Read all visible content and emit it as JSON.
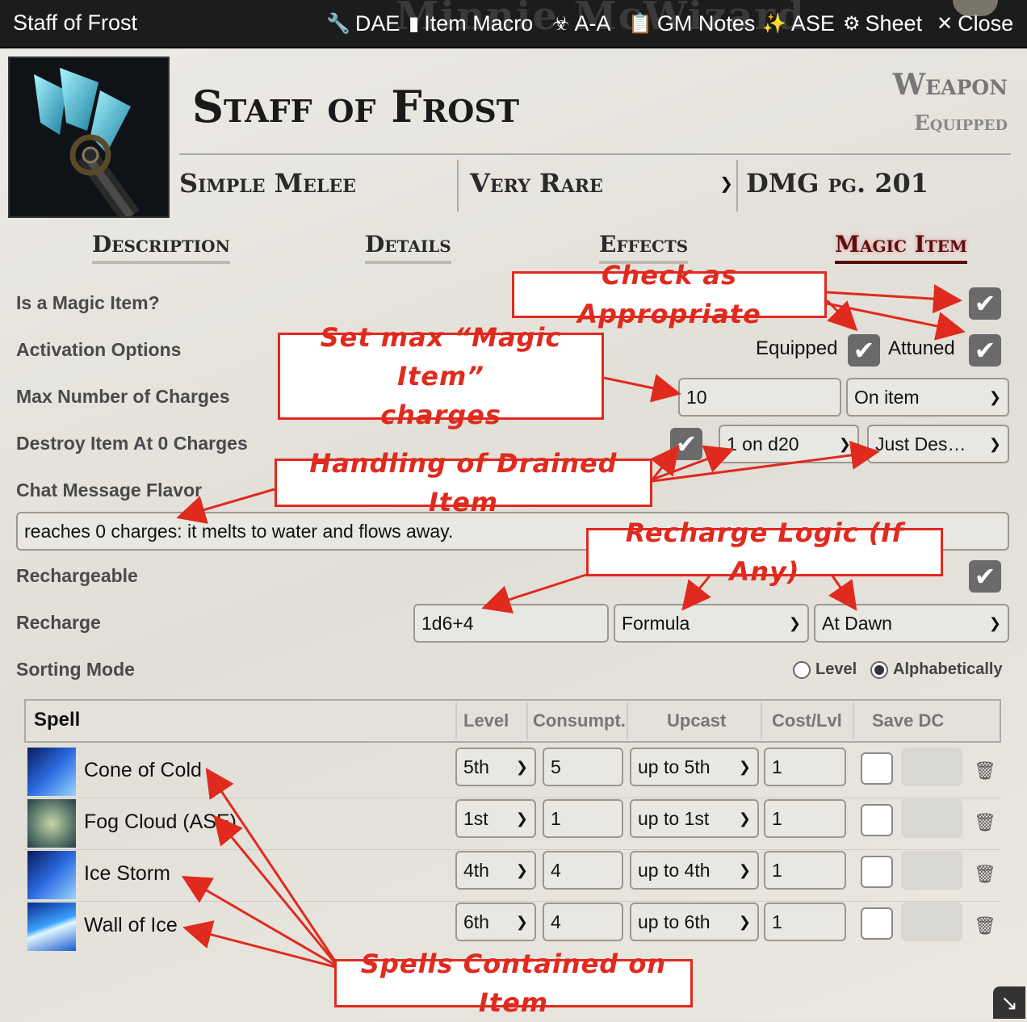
{
  "header": {
    "window_title": "Staff of Frost",
    "background_name": "Minnie McWizard",
    "buttons": [
      {
        "icon": "wrench-icon",
        "glyph": "🔧",
        "label": "DAE"
      },
      {
        "icon": "sd-card-icon",
        "glyph": "▮",
        "label": "Item Macro"
      },
      {
        "icon": "biohazard-icon",
        "glyph": "☣",
        "label": "A-A"
      },
      {
        "icon": "clipboard-icon",
        "glyph": "📋",
        "label": "GM Notes"
      },
      {
        "icon": "magic-wand-icon",
        "glyph": "✨",
        "label": "ASE"
      },
      {
        "icon": "gear-icon",
        "glyph": "⚙",
        "label": "Sheet"
      },
      {
        "icon": "close-icon",
        "glyph": "✕",
        "label": "Close"
      }
    ]
  },
  "item": {
    "name": "Staff of Frost",
    "type": "Weapon",
    "status": "Equipped",
    "weapon_type": "Simple Melee",
    "rarity": "Very Rare",
    "source": "DMG pg. 201"
  },
  "tabs": [
    "Description",
    "Details",
    "Effects",
    "Magic Item"
  ],
  "active_tab": "Magic Item",
  "form": {
    "is_magic_item_label": "Is a Magic Item?",
    "activation_label": "Activation Options",
    "equipped_label": "Equipped",
    "attuned_label": "Attuned",
    "max_charges_label": "Max Number of Charges",
    "max_charges_value": "10",
    "charges_mode": "On item",
    "destroy_label": "Destroy Item At 0 Charges",
    "destroy_check_value": "1 on d20",
    "destroy_mode": "Just Des…",
    "flavor_label": "Chat Message Flavor",
    "flavor_value": "reaches 0 charges: it melts to water and flows away.",
    "rechargeable_label": "Rechargeable",
    "recharge_label": "Recharge",
    "recharge_value": "1d6+4",
    "recharge_type": "Formula",
    "recharge_time": "At Dawn",
    "sorting_label": "Sorting Mode",
    "sorting_options": [
      "Level",
      "Alphabetically"
    ],
    "sorting_selected": "Alphabetically"
  },
  "spells_table": {
    "headers": [
      "Spell",
      "Level",
      "Consumpt.",
      "Upcast",
      "Cost/Lvl",
      "Save DC"
    ],
    "rows": [
      {
        "name": "Cone of Cold",
        "level": "5th",
        "consumption": "5",
        "upcast": "up to 5th",
        "cost": "1",
        "icon": "cone-of-cold-icon"
      },
      {
        "name": "Fog Cloud (ASE)",
        "level": "1st",
        "consumption": "1",
        "upcast": "up to 1st",
        "cost": "1",
        "icon": "fog-cloud-icon"
      },
      {
        "name": "Ice Storm",
        "level": "4th",
        "consumption": "4",
        "upcast": "up to 4th",
        "cost": "1",
        "icon": "ice-storm-icon"
      },
      {
        "name": "Wall of Ice",
        "level": "6th",
        "consumption": "4",
        "upcast": "up to 6th",
        "cost": "1",
        "icon": "wall-of-ice-icon"
      }
    ]
  },
  "annotations": {
    "check": "Check as Appropriate",
    "max_charges_line1": "Set max “Magic Item”",
    "max_charges_line2": "charges",
    "drained": "Handling of Drained Item",
    "recharge": "Recharge Logic (If Any)",
    "spells": "Spells Contained on Item"
  },
  "colors": {
    "annotation": "#e02a1e",
    "active_tab": "#5a0f0f",
    "header_bg": "#1c1c1c"
  }
}
